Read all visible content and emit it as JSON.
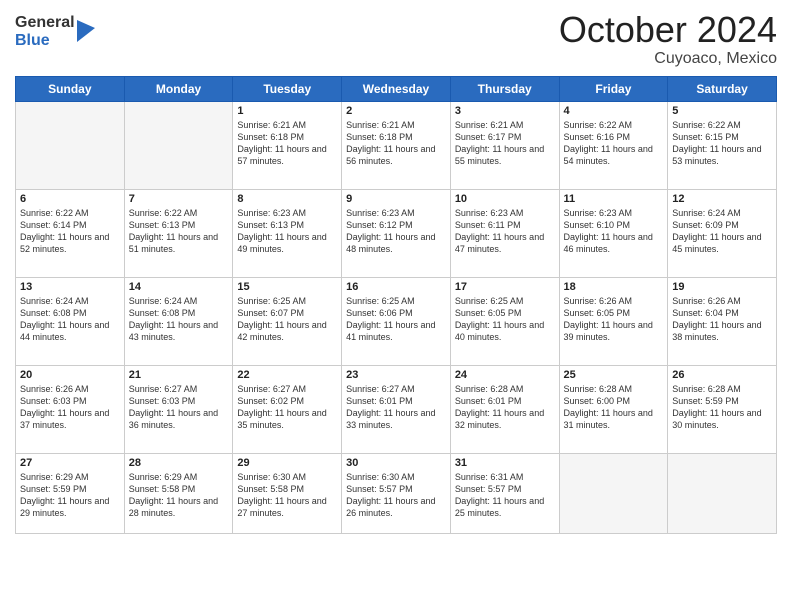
{
  "header": {
    "logo_general": "General",
    "logo_blue": "Blue",
    "month_title": "October 2024",
    "location": "Cuyoaco, Mexico"
  },
  "days_of_week": [
    "Sunday",
    "Monday",
    "Tuesday",
    "Wednesday",
    "Thursday",
    "Friday",
    "Saturday"
  ],
  "weeks": [
    [
      {
        "day": "",
        "info": ""
      },
      {
        "day": "",
        "info": ""
      },
      {
        "day": "1",
        "info": "Sunrise: 6:21 AM\nSunset: 6:18 PM\nDaylight: 11 hours and 57 minutes."
      },
      {
        "day": "2",
        "info": "Sunrise: 6:21 AM\nSunset: 6:18 PM\nDaylight: 11 hours and 56 minutes."
      },
      {
        "day": "3",
        "info": "Sunrise: 6:21 AM\nSunset: 6:17 PM\nDaylight: 11 hours and 55 minutes."
      },
      {
        "day": "4",
        "info": "Sunrise: 6:22 AM\nSunset: 6:16 PM\nDaylight: 11 hours and 54 minutes."
      },
      {
        "day": "5",
        "info": "Sunrise: 6:22 AM\nSunset: 6:15 PM\nDaylight: 11 hours and 53 minutes."
      }
    ],
    [
      {
        "day": "6",
        "info": "Sunrise: 6:22 AM\nSunset: 6:14 PM\nDaylight: 11 hours and 52 minutes."
      },
      {
        "day": "7",
        "info": "Sunrise: 6:22 AM\nSunset: 6:13 PM\nDaylight: 11 hours and 51 minutes."
      },
      {
        "day": "8",
        "info": "Sunrise: 6:23 AM\nSunset: 6:13 PM\nDaylight: 11 hours and 49 minutes."
      },
      {
        "day": "9",
        "info": "Sunrise: 6:23 AM\nSunset: 6:12 PM\nDaylight: 11 hours and 48 minutes."
      },
      {
        "day": "10",
        "info": "Sunrise: 6:23 AM\nSunset: 6:11 PM\nDaylight: 11 hours and 47 minutes."
      },
      {
        "day": "11",
        "info": "Sunrise: 6:23 AM\nSunset: 6:10 PM\nDaylight: 11 hours and 46 minutes."
      },
      {
        "day": "12",
        "info": "Sunrise: 6:24 AM\nSunset: 6:09 PM\nDaylight: 11 hours and 45 minutes."
      }
    ],
    [
      {
        "day": "13",
        "info": "Sunrise: 6:24 AM\nSunset: 6:08 PM\nDaylight: 11 hours and 44 minutes."
      },
      {
        "day": "14",
        "info": "Sunrise: 6:24 AM\nSunset: 6:08 PM\nDaylight: 11 hours and 43 minutes."
      },
      {
        "day": "15",
        "info": "Sunrise: 6:25 AM\nSunset: 6:07 PM\nDaylight: 11 hours and 42 minutes."
      },
      {
        "day": "16",
        "info": "Sunrise: 6:25 AM\nSunset: 6:06 PM\nDaylight: 11 hours and 41 minutes."
      },
      {
        "day": "17",
        "info": "Sunrise: 6:25 AM\nSunset: 6:05 PM\nDaylight: 11 hours and 40 minutes."
      },
      {
        "day": "18",
        "info": "Sunrise: 6:26 AM\nSunset: 6:05 PM\nDaylight: 11 hours and 39 minutes."
      },
      {
        "day": "19",
        "info": "Sunrise: 6:26 AM\nSunset: 6:04 PM\nDaylight: 11 hours and 38 minutes."
      }
    ],
    [
      {
        "day": "20",
        "info": "Sunrise: 6:26 AM\nSunset: 6:03 PM\nDaylight: 11 hours and 37 minutes."
      },
      {
        "day": "21",
        "info": "Sunrise: 6:27 AM\nSunset: 6:03 PM\nDaylight: 11 hours and 36 minutes."
      },
      {
        "day": "22",
        "info": "Sunrise: 6:27 AM\nSunset: 6:02 PM\nDaylight: 11 hours and 35 minutes."
      },
      {
        "day": "23",
        "info": "Sunrise: 6:27 AM\nSunset: 6:01 PM\nDaylight: 11 hours and 33 minutes."
      },
      {
        "day": "24",
        "info": "Sunrise: 6:28 AM\nSunset: 6:01 PM\nDaylight: 11 hours and 32 minutes."
      },
      {
        "day": "25",
        "info": "Sunrise: 6:28 AM\nSunset: 6:00 PM\nDaylight: 11 hours and 31 minutes."
      },
      {
        "day": "26",
        "info": "Sunrise: 6:28 AM\nSunset: 5:59 PM\nDaylight: 11 hours and 30 minutes."
      }
    ],
    [
      {
        "day": "27",
        "info": "Sunrise: 6:29 AM\nSunset: 5:59 PM\nDaylight: 11 hours and 29 minutes."
      },
      {
        "day": "28",
        "info": "Sunrise: 6:29 AM\nSunset: 5:58 PM\nDaylight: 11 hours and 28 minutes."
      },
      {
        "day": "29",
        "info": "Sunrise: 6:30 AM\nSunset: 5:58 PM\nDaylight: 11 hours and 27 minutes."
      },
      {
        "day": "30",
        "info": "Sunrise: 6:30 AM\nSunset: 5:57 PM\nDaylight: 11 hours and 26 minutes."
      },
      {
        "day": "31",
        "info": "Sunrise: 6:31 AM\nSunset: 5:57 PM\nDaylight: 11 hours and 25 minutes."
      },
      {
        "day": "",
        "info": ""
      },
      {
        "day": "",
        "info": ""
      }
    ]
  ]
}
